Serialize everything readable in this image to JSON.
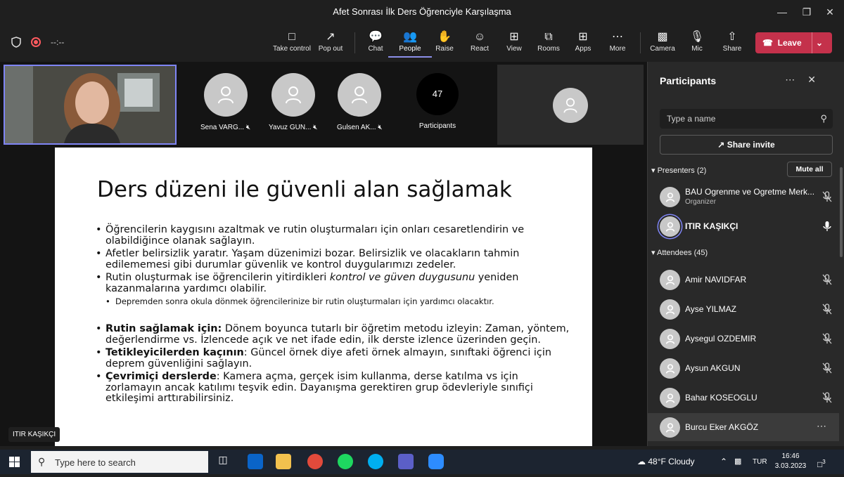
{
  "window": {
    "title": "Afet Sonrası İlk Ders Öğrenciyle Karşılaşma"
  },
  "toolbar": {
    "timer": "--:--",
    "buttons": [
      {
        "label": "Take control",
        "icon": "take-control-icon"
      },
      {
        "label": "Pop out",
        "icon": "pop-out-icon"
      },
      {
        "label": "Chat",
        "icon": "chat-icon"
      },
      {
        "label": "People",
        "icon": "people-icon",
        "active": true
      },
      {
        "label": "Raise",
        "icon": "raise-hand-icon"
      },
      {
        "label": "React",
        "icon": "react-icon"
      },
      {
        "label": "View",
        "icon": "view-icon"
      },
      {
        "label": "Rooms",
        "icon": "rooms-icon"
      },
      {
        "label": "Apps",
        "icon": "apps-icon"
      },
      {
        "label": "More",
        "icon": "more-icon"
      },
      {
        "label": "Camera",
        "icon": "camera-off-icon"
      },
      {
        "label": "Mic",
        "icon": "mic-off-icon"
      },
      {
        "label": "Share",
        "icon": "share-icon"
      }
    ],
    "leave_label": "Leave",
    "leave_color": "#c4314b",
    "accent_color": "#7f85f5"
  },
  "stage": {
    "tiles": [
      {
        "name": "Sena VARG...",
        "muted": true
      },
      {
        "name": "Yavuz GUN...",
        "muted": true
      },
      {
        "name": "Gulsen AK...",
        "muted": true
      }
    ],
    "participants_count": "47",
    "participants_label": "Participants",
    "presenter_tag": "ITIR KAŞIKÇI"
  },
  "slide": {
    "title": "Ders düzeni ile güvenli alan sağlamak",
    "b1": "Öğrencilerin kaygısını azaltmak ve rutin oluşturmaları için onları cesaretlendirin ve olabildiğince olanak sağlayın.",
    "b2": "Afetler belirsizlik yaratır. Yaşam düzenimizi bozar. Belirsizlik ve olacakların tahmin edilememesi gibi durumlar güvenlik ve kontrol duygularımızı zedeler.",
    "b3_pre": "Rutin oluşturmak ise öğrencilerin yitirdikleri ",
    "b3_em": "kontrol ve güven duygusunu",
    "b3_post": " yeniden kazanmalarına yardımcı olabilir.",
    "b3_sub": "Depremden sonra okula dönmek öğrencilerinize bir rutin oluşturmaları için yardımcı olacaktır.",
    "b4_bold": "Rutin sağlamak için:",
    "b4_rest": " Dönem boyunca tutarlı bir öğretim metodu izleyin: Zaman, yöntem, değerlendirme vs. İzlencede açık ve net ifade edin, ilk derste izlence üzerinden geçin.",
    "b5_bold": "Tetikleyicilerden kaçının",
    "b5_rest": ": Güncel örnek diye afeti örnek almayın, sınıftaki öğrenci için deprem güvenliğini sağlayın.",
    "b6_bold": "Çevrimiçi derslerde",
    "b6_rest": ": Kamera açma, gerçek isim kullanma, derse katılma vs için zorlamayın ancak katılımı teşvik edin. Dayanışma gerektiren grup ödevleriyle sınıfiçi etkileşimi arttırabilirsiniz."
  },
  "panel": {
    "title": "Participants",
    "search_placeholder": "Type a name",
    "share_invite": "Share invite",
    "presenters_header": "Presenters (2)",
    "mute_all": "Mute all",
    "presenters": [
      {
        "name": "BAU Ogrenme ve Ogretme Merk...",
        "role": "Organizer",
        "mic": "muted"
      },
      {
        "name": "ITIR KAŞIKÇI",
        "role": "",
        "mic": "on"
      }
    ],
    "attendees_header": "Attendees (45)",
    "attendees": [
      {
        "name": "Amir NAVIDFAR",
        "mic": "muted"
      },
      {
        "name": "Ayse YILMAZ",
        "mic": "muted"
      },
      {
        "name": "Aysegul OZDEMIR",
        "mic": "muted"
      },
      {
        "name": "Aysun AKGUN",
        "mic": "muted"
      },
      {
        "name": "Bahar KOSEOGLU",
        "mic": "muted"
      },
      {
        "name": "Burcu Eker AKGÖZ",
        "mic": "more"
      }
    ]
  },
  "taskbar": {
    "search_placeholder": "Type here to search",
    "weather": "48°F  Cloudy",
    "lang": "TUR",
    "time": "16:46",
    "date": "3.03.2023",
    "notifications": "3"
  }
}
